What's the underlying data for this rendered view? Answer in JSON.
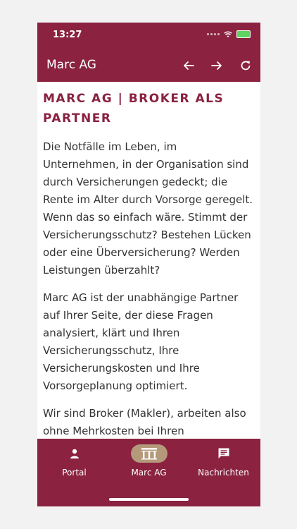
{
  "status_bar": {
    "time": "13:27"
  },
  "app_bar": {
    "title": "Marc AG",
    "back_icon": "arrow-left-icon",
    "forward_icon": "arrow-right-icon",
    "reload_icon": "reload-icon"
  },
  "content": {
    "heading": "MARC AG | BROKER ALS PARTNER",
    "paragraphs": [
      "Die Notfälle im Leben, im Unternehmen, in der Organisation sind durch Versicherungen gedeckt; die Rente im Alter durch Vorsorge geregelt. Wenn das so einfach wäre. Stimmt der Versicherungsschutz? Bestehen Lücken oder eine Überversicherung? Werden Leistungen überzahlt?",
      "Marc AG ist der unabhängige Partner auf Ihrer Seite, der diese Fragen analysiert, klärt und Ihren Versicherungsschutz, Ihre Versicherungskosten und Ihre Vorsorgeplanung optimiert.",
      "Wir sind Broker (Makler), arbeiten also ohne Mehrkosten bei Ihren"
    ]
  },
  "tab_bar": {
    "tabs": [
      {
        "label": "Portal",
        "icon": "person-icon"
      },
      {
        "label": "Marc AG",
        "icon": "building-icon",
        "active": true
      },
      {
        "label": "Nachrichten",
        "icon": "message-icon"
      }
    ]
  },
  "colors": {
    "brand": "#8a2240",
    "active_pill": "#b4997a",
    "text": "#333333"
  }
}
